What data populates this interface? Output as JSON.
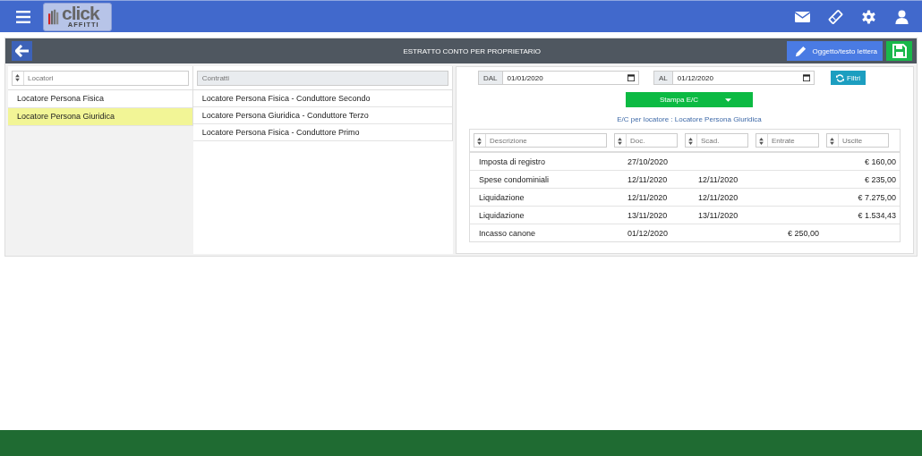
{
  "logo": {
    "name": "click",
    "tagline": "AFFITTI"
  },
  "toolbar": {
    "title": "ESTRATTO CONTO PER PROPRIETARIO",
    "letter_button": "Oggetto/testo lettera"
  },
  "locatori": {
    "placeholder": "Locatori",
    "items": [
      {
        "label": "Locatore Persona Fisica",
        "selected": false
      },
      {
        "label": "Locatore Persona Giuridica",
        "selected": true
      }
    ]
  },
  "contratti": {
    "placeholder": "Contratti",
    "disabled": true,
    "items": [
      {
        "label": "Locatore Persona Fisica - Conduttore Secondo"
      },
      {
        "label": "Locatore Persona Giuridica - Conduttore Terzo"
      },
      {
        "label": "Locatore Persona Fisica - Conduttore Primo"
      }
    ]
  },
  "period": {
    "from_label": "DAL",
    "from_value": "01/01/2020",
    "to_label": "AL",
    "to_value": "01/12/2020",
    "filter_button": "Filtri"
  },
  "print_button": "Stampa E/C",
  "caption": "E/C per locatore : Locatore Persona Giuridica",
  "table": {
    "columns": [
      {
        "placeholder": "Descrizione"
      },
      {
        "placeholder": "Doc."
      },
      {
        "placeholder": "Scad."
      },
      {
        "placeholder": "Entrate"
      },
      {
        "placeholder": "Uscite"
      }
    ],
    "rows": [
      [
        "Imposta di registro",
        "27/10/2020",
        "",
        "",
        "€ 160,00"
      ],
      [
        "Spese condominiali",
        "12/11/2020",
        "12/11/2020",
        "",
        "€ 235,00"
      ],
      [
        "Liquidazione",
        "12/11/2020",
        "12/11/2020",
        "",
        "€ 7.275,00"
      ],
      [
        "Liquidazione",
        "13/11/2020",
        "13/11/2020",
        "",
        "€ 1.534,43"
      ],
      [
        "Incasso canone",
        "01/12/2020",
        "",
        "€ 250,00",
        ""
      ]
    ]
  }
}
